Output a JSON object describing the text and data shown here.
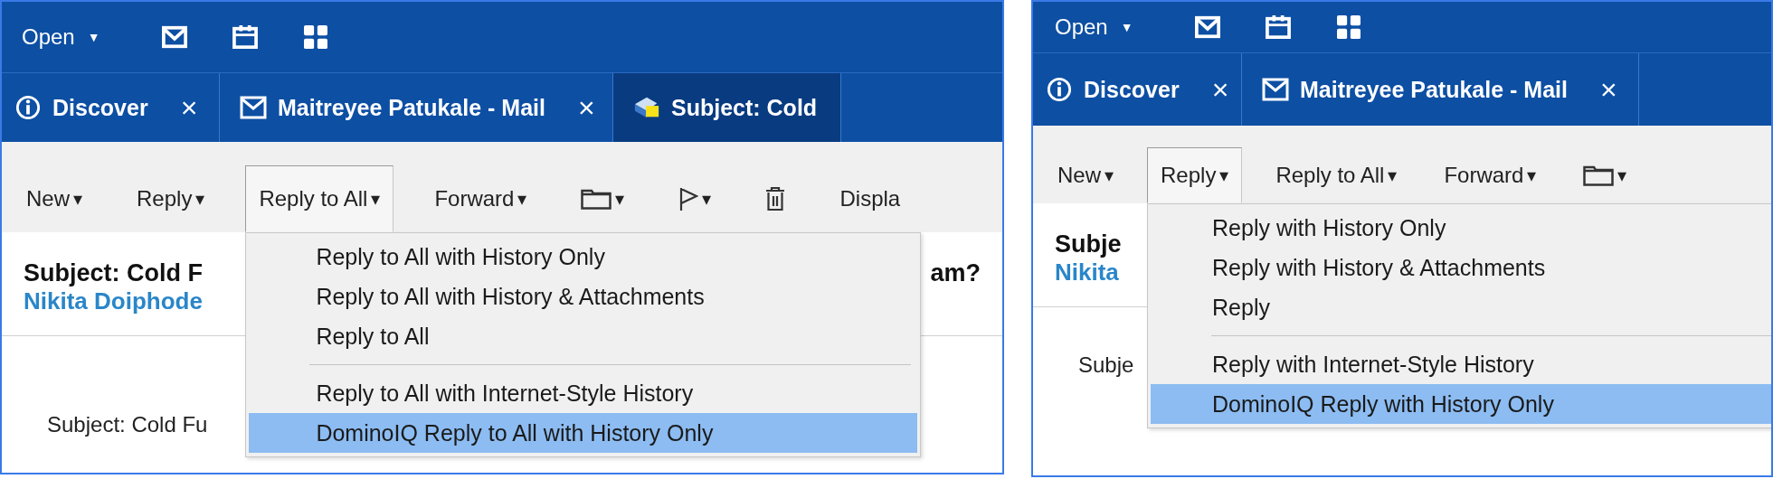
{
  "panels": [
    {
      "top_bar": {
        "open_label": "Open",
        "open_caret": "▼"
      },
      "tabs": [
        {
          "label": "Discover",
          "kind": "info",
          "close": "×",
          "selected": false
        },
        {
          "label": "Maitreyee Patukale - Mail",
          "kind": "mail",
          "close": "×",
          "selected": false
        },
        {
          "label": "Subject: Cold",
          "kind": "memo",
          "selected": true
        }
      ],
      "toolbar": [
        {
          "kind": "menu",
          "label": "New",
          "caret": "▾",
          "pressed": false
        },
        {
          "kind": "menu",
          "label": "Reply",
          "caret": "▾",
          "pressed": false
        },
        {
          "kind": "menu",
          "label": "Reply to All",
          "caret": "▾",
          "pressed": true
        },
        {
          "kind": "menu",
          "label": "Forward",
          "caret": "▾",
          "pressed": false
        },
        {
          "kind": "folder",
          "caret": "▾",
          "pressed": false
        },
        {
          "kind": "flag",
          "caret": "▾",
          "pressed": false
        },
        {
          "kind": "trash",
          "pressed": false
        },
        {
          "kind": "text",
          "label": "Displa",
          "pressed": false
        }
      ],
      "menu": [
        {
          "label": "Reply to All with History Only",
          "separator_before": false,
          "selected": false
        },
        {
          "label": "Reply to All with History & Attachments",
          "separator_before": false,
          "selected": false
        },
        {
          "label": "Reply to All",
          "separator_before": false,
          "selected": false
        },
        {
          "label": "Reply to All with Internet-Style History",
          "separator_before": true,
          "selected": false
        },
        {
          "label": "DominoIQ Reply to All with History Only",
          "separator_before": false,
          "selected": true
        }
      ],
      "message": {
        "subject": "Subject: Cold F",
        "subject_end": "am?",
        "sender": "Nikita Doiphode",
        "body": "Subject: Cold Fu"
      }
    },
    {
      "top_bar": {
        "open_label": "Open",
        "open_caret": "▼"
      },
      "tabs": [
        {
          "label": "Discover",
          "kind": "info",
          "close": "×",
          "selected": false
        },
        {
          "label": "Maitreyee Patukale - Mail",
          "kind": "mail",
          "close": "×",
          "selected": false
        }
      ],
      "toolbar": [
        {
          "kind": "menu",
          "label": "New",
          "caret": "▾",
          "pressed": false
        },
        {
          "kind": "menu",
          "label": "Reply",
          "caret": "▾",
          "pressed": true
        },
        {
          "kind": "menu",
          "label": "Reply to All",
          "caret": "▾",
          "pressed": false
        },
        {
          "kind": "menu",
          "label": "Forward",
          "caret": "▾",
          "pressed": false
        },
        {
          "kind": "folder",
          "caret": "▾",
          "pressed": false
        }
      ],
      "menu": [
        {
          "label": "Reply with History Only",
          "separator_before": false,
          "selected": false
        },
        {
          "label": "Reply with History & Attachments",
          "separator_before": false,
          "selected": false
        },
        {
          "label": "Reply",
          "separator_before": false,
          "selected": false
        },
        {
          "label": "Reply with Internet-Style History",
          "separator_before": true,
          "selected": false
        },
        {
          "label": "DominoIQ Reply with History Only",
          "separator_before": false,
          "selected": true
        }
      ],
      "message": {
        "subject": "Subje",
        "sender": "Nikita",
        "body": "Subje"
      }
    }
  ]
}
